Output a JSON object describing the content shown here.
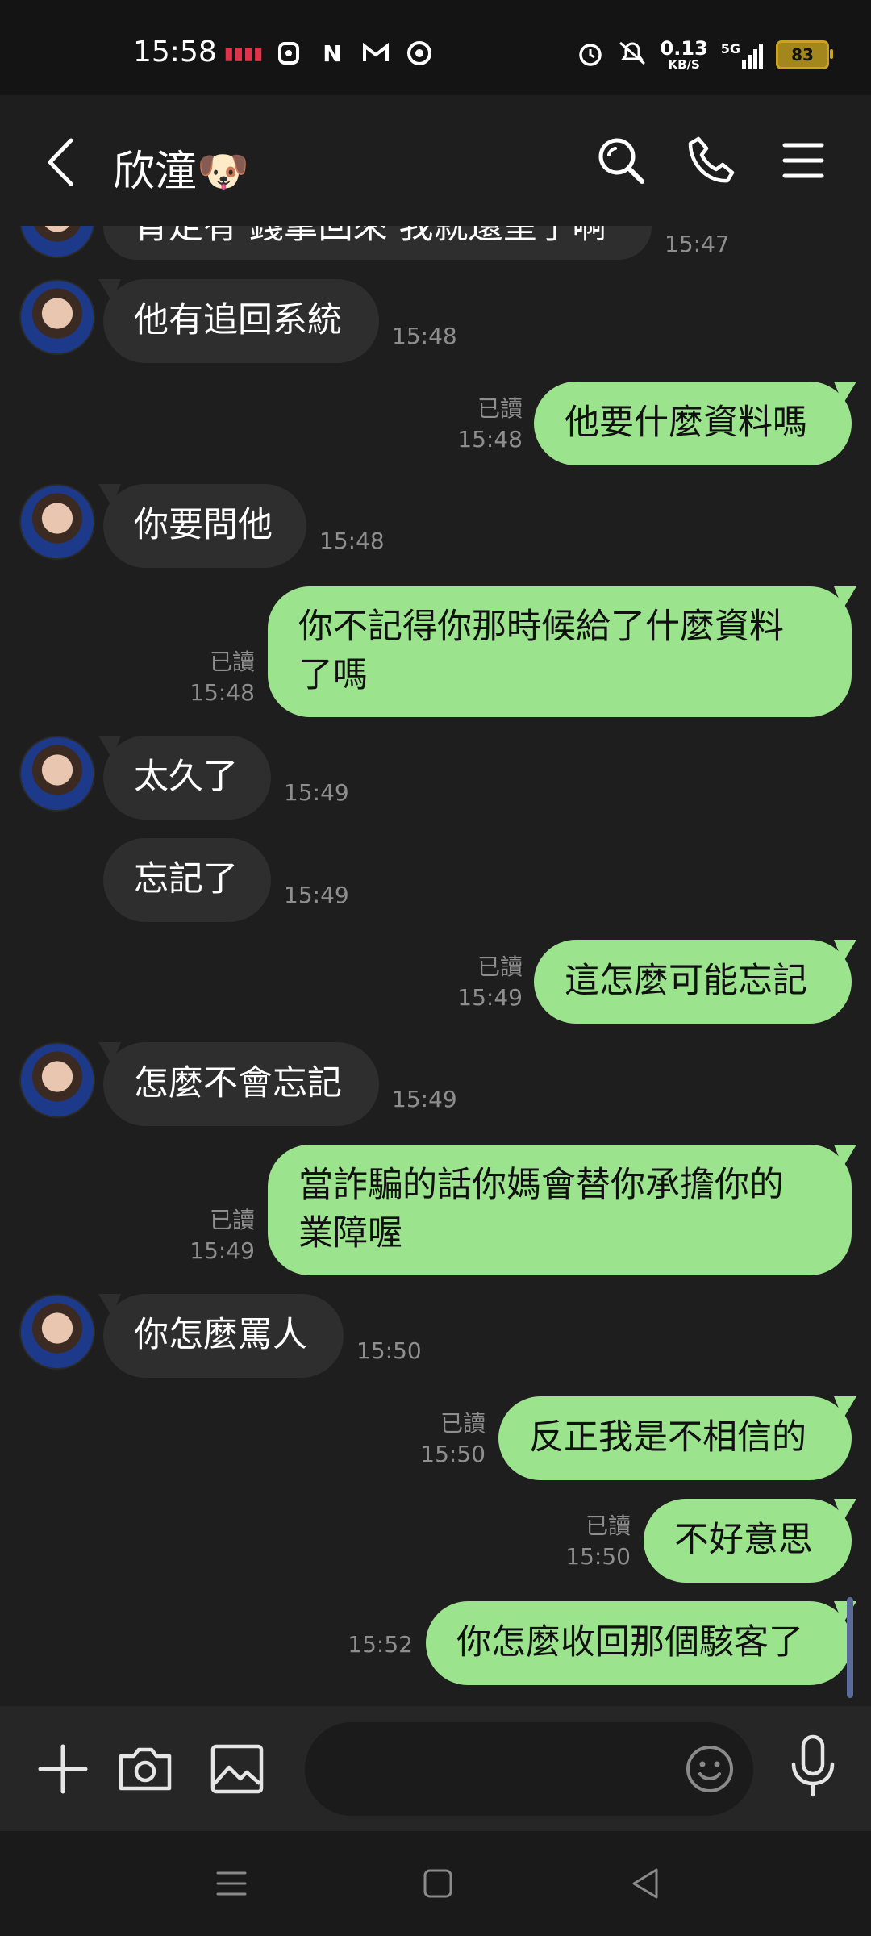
{
  "status_bar": {
    "time": "15:58",
    "icons_left": [
      "signal-red-icon",
      "d-icon",
      "n-icon",
      "gmail-icon",
      "chrome-icon"
    ],
    "net_speed": "0.13",
    "net_unit": "KB/S",
    "network": "5G",
    "battery": "83"
  },
  "header": {
    "title": "欣潼🐶"
  },
  "messages": [
    {
      "dir": "in",
      "text": "肯定有 錢拿回來 我就還呈了啊",
      "time": "15:47"
    },
    {
      "dir": "in",
      "text": "他有追回系統",
      "time": "15:48"
    },
    {
      "dir": "out",
      "text": "他要什麼資料嗎",
      "read": "已讀",
      "time": "15:48"
    },
    {
      "dir": "in",
      "text": "你要問他",
      "time": "15:48"
    },
    {
      "dir": "out",
      "line1": "你不記得你那時候給了什麼資料",
      "line2": "了嗎",
      "read": "已讀",
      "time": "15:48"
    },
    {
      "dir": "in",
      "text": "太久了",
      "time": "15:49"
    },
    {
      "dir": "in",
      "text": "忘記了",
      "time": "15:49"
    },
    {
      "dir": "out",
      "text": "這怎麼可能忘記",
      "read": "已讀",
      "time": "15:49"
    },
    {
      "dir": "in",
      "text": "怎麼不會忘記",
      "time": "15:49"
    },
    {
      "dir": "out",
      "line1": "當詐騙的話你媽會替你承擔你的",
      "line2": "業障喔",
      "read": "已讀",
      "time": "15:49"
    },
    {
      "dir": "in",
      "text": "你怎麼罵人",
      "time": "15:50"
    },
    {
      "dir": "out",
      "text": "反正我是不相信的",
      "read": "已讀",
      "time": "15:50"
    },
    {
      "dir": "out",
      "text": "不好意思",
      "read": "已讀",
      "time": "15:50"
    },
    {
      "dir": "out",
      "text": "你怎麼收回那個駭客了",
      "time": "15:52"
    }
  ],
  "input": {
    "placeholder": ""
  },
  "colors": {
    "background": "#1e1e1e",
    "outgoing_bubble": "#9ce38d",
    "incoming_bubble": "#2e2e2e"
  }
}
